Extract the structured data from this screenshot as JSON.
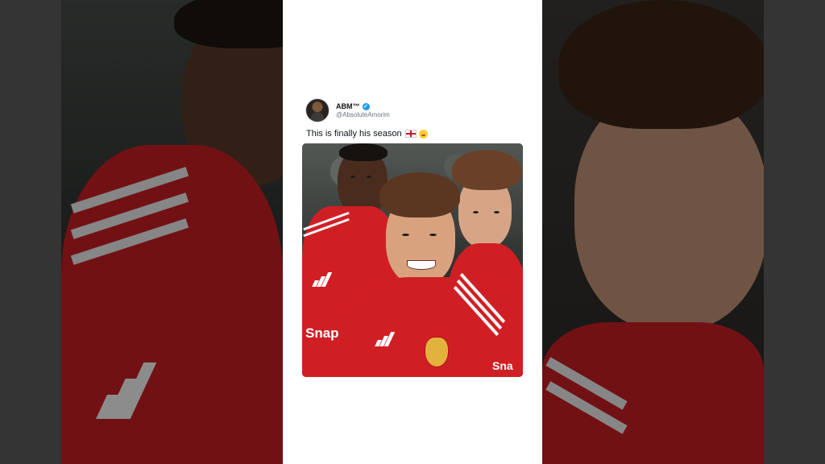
{
  "tweet": {
    "display_name": "ABM™",
    "handle": "@AbsoluteAmorim",
    "text": "This is finally his season",
    "verified_icon": "verified-badge-icon",
    "emojis": [
      "england-flag",
      "hugging-face"
    ]
  },
  "photo": {
    "sponsor_text": "Snap",
    "sponsor_text_right": "Sna"
  },
  "colors": {
    "card_bg": "#ffffff",
    "kit_red": "#d01f24",
    "verified_blue": "#1d9bf0"
  }
}
